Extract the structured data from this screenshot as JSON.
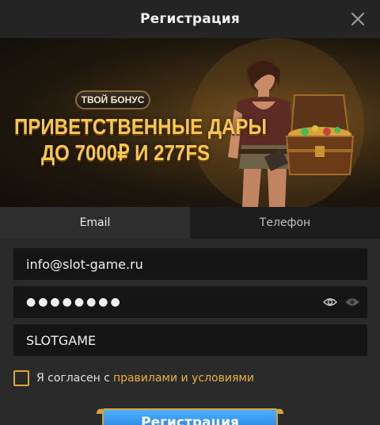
{
  "header": {
    "title": "Регистрация",
    "close_icon": "close-icon"
  },
  "banner": {
    "badge": "ТВОЙ БОНУС",
    "line1": "ПРИВЕТСТВЕННЫЕ ДАРЫ",
    "line2": "ДО 7000₽ И 277FS"
  },
  "tabs": [
    {
      "label": "Email",
      "active": true
    },
    {
      "label": "Телефон",
      "active": false
    }
  ],
  "form": {
    "email_value": "info@slot-game.ru",
    "password_masked": "●●●●●●●●",
    "promo_value": "SLOTGAME",
    "agree_text": "Я согласен с",
    "agree_link": "правилами и условиями",
    "submit_label": "Регистрация"
  },
  "colors": {
    "accent": "#e8b23c",
    "button": "#2a8ae6",
    "background": "#2a2a2a"
  }
}
